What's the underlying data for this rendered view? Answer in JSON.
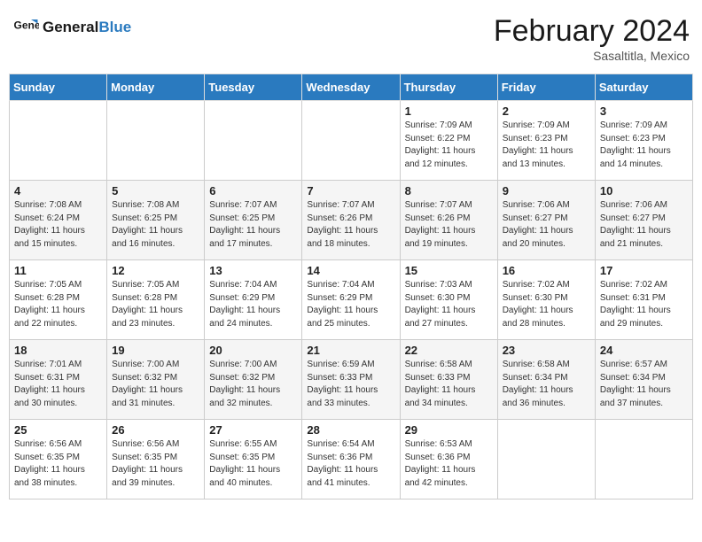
{
  "header": {
    "logo_text_general": "General",
    "logo_text_blue": "Blue",
    "title": "February 2024",
    "subtitle": "Sasaltitla, Mexico"
  },
  "weekdays": [
    "Sunday",
    "Monday",
    "Tuesday",
    "Wednesday",
    "Thursday",
    "Friday",
    "Saturday"
  ],
  "weeks": [
    [
      {
        "day": "",
        "info": ""
      },
      {
        "day": "",
        "info": ""
      },
      {
        "day": "",
        "info": ""
      },
      {
        "day": "",
        "info": ""
      },
      {
        "day": "1",
        "info": "Sunrise: 7:09 AM\nSunset: 6:22 PM\nDaylight: 11 hours and 12 minutes."
      },
      {
        "day": "2",
        "info": "Sunrise: 7:09 AM\nSunset: 6:23 PM\nDaylight: 11 hours and 13 minutes."
      },
      {
        "day": "3",
        "info": "Sunrise: 7:09 AM\nSunset: 6:23 PM\nDaylight: 11 hours and 14 minutes."
      }
    ],
    [
      {
        "day": "4",
        "info": "Sunrise: 7:08 AM\nSunset: 6:24 PM\nDaylight: 11 hours and 15 minutes."
      },
      {
        "day": "5",
        "info": "Sunrise: 7:08 AM\nSunset: 6:25 PM\nDaylight: 11 hours and 16 minutes."
      },
      {
        "day": "6",
        "info": "Sunrise: 7:07 AM\nSunset: 6:25 PM\nDaylight: 11 hours and 17 minutes."
      },
      {
        "day": "7",
        "info": "Sunrise: 7:07 AM\nSunset: 6:26 PM\nDaylight: 11 hours and 18 minutes."
      },
      {
        "day": "8",
        "info": "Sunrise: 7:07 AM\nSunset: 6:26 PM\nDaylight: 11 hours and 19 minutes."
      },
      {
        "day": "9",
        "info": "Sunrise: 7:06 AM\nSunset: 6:27 PM\nDaylight: 11 hours and 20 minutes."
      },
      {
        "day": "10",
        "info": "Sunrise: 7:06 AM\nSunset: 6:27 PM\nDaylight: 11 hours and 21 minutes."
      }
    ],
    [
      {
        "day": "11",
        "info": "Sunrise: 7:05 AM\nSunset: 6:28 PM\nDaylight: 11 hours and 22 minutes."
      },
      {
        "day": "12",
        "info": "Sunrise: 7:05 AM\nSunset: 6:28 PM\nDaylight: 11 hours and 23 minutes."
      },
      {
        "day": "13",
        "info": "Sunrise: 7:04 AM\nSunset: 6:29 PM\nDaylight: 11 hours and 24 minutes."
      },
      {
        "day": "14",
        "info": "Sunrise: 7:04 AM\nSunset: 6:29 PM\nDaylight: 11 hours and 25 minutes."
      },
      {
        "day": "15",
        "info": "Sunrise: 7:03 AM\nSunset: 6:30 PM\nDaylight: 11 hours and 27 minutes."
      },
      {
        "day": "16",
        "info": "Sunrise: 7:02 AM\nSunset: 6:30 PM\nDaylight: 11 hours and 28 minutes."
      },
      {
        "day": "17",
        "info": "Sunrise: 7:02 AM\nSunset: 6:31 PM\nDaylight: 11 hours and 29 minutes."
      }
    ],
    [
      {
        "day": "18",
        "info": "Sunrise: 7:01 AM\nSunset: 6:31 PM\nDaylight: 11 hours and 30 minutes."
      },
      {
        "day": "19",
        "info": "Sunrise: 7:00 AM\nSunset: 6:32 PM\nDaylight: 11 hours and 31 minutes."
      },
      {
        "day": "20",
        "info": "Sunrise: 7:00 AM\nSunset: 6:32 PM\nDaylight: 11 hours and 32 minutes."
      },
      {
        "day": "21",
        "info": "Sunrise: 6:59 AM\nSunset: 6:33 PM\nDaylight: 11 hours and 33 minutes."
      },
      {
        "day": "22",
        "info": "Sunrise: 6:58 AM\nSunset: 6:33 PM\nDaylight: 11 hours and 34 minutes."
      },
      {
        "day": "23",
        "info": "Sunrise: 6:58 AM\nSunset: 6:34 PM\nDaylight: 11 hours and 36 minutes."
      },
      {
        "day": "24",
        "info": "Sunrise: 6:57 AM\nSunset: 6:34 PM\nDaylight: 11 hours and 37 minutes."
      }
    ],
    [
      {
        "day": "25",
        "info": "Sunrise: 6:56 AM\nSunset: 6:35 PM\nDaylight: 11 hours and 38 minutes."
      },
      {
        "day": "26",
        "info": "Sunrise: 6:56 AM\nSunset: 6:35 PM\nDaylight: 11 hours and 39 minutes."
      },
      {
        "day": "27",
        "info": "Sunrise: 6:55 AM\nSunset: 6:35 PM\nDaylight: 11 hours and 40 minutes."
      },
      {
        "day": "28",
        "info": "Sunrise: 6:54 AM\nSunset: 6:36 PM\nDaylight: 11 hours and 41 minutes."
      },
      {
        "day": "29",
        "info": "Sunrise: 6:53 AM\nSunset: 6:36 PM\nDaylight: 11 hours and 42 minutes."
      },
      {
        "day": "",
        "info": ""
      },
      {
        "day": "",
        "info": ""
      }
    ]
  ]
}
